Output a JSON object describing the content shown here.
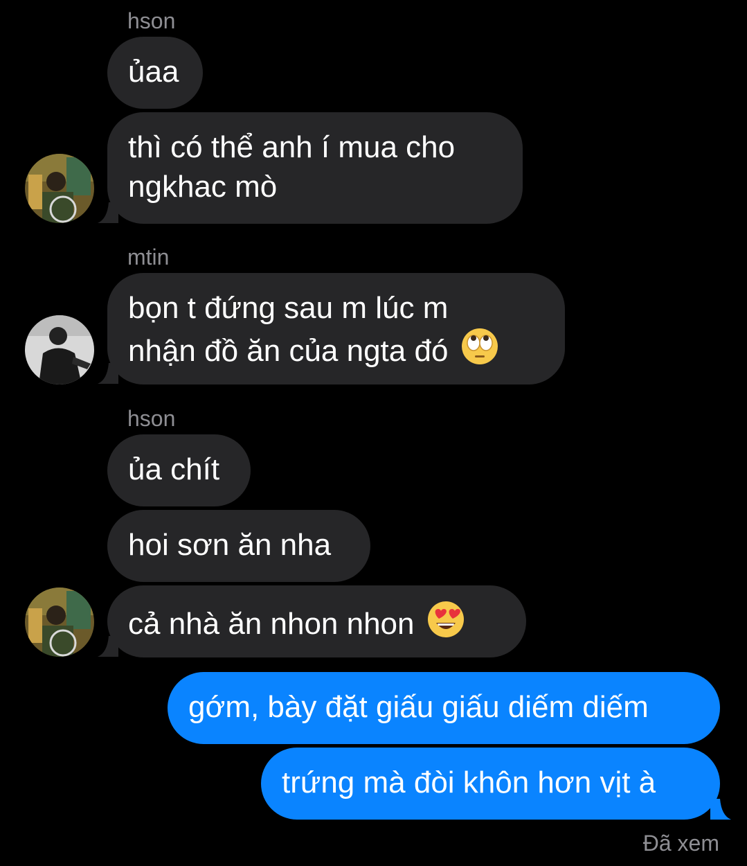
{
  "thread": {
    "groups": [
      {
        "sender": "hson"
      },
      {
        "sender": "mtin"
      },
      {
        "sender": "hson"
      }
    ],
    "messages": [
      {
        "text": "ủaa"
      },
      {
        "lines": [
          "thì có thể anh í mua cho",
          "ngkhac mò"
        ]
      },
      {
        "lines": [
          "bọn t đứng sau m lúc m",
          "nhận đồ ăn của ngta đó"
        ],
        "emoji": "face-with-rolling-eyes"
      },
      {
        "text": "ủa chít"
      },
      {
        "text": "hoi sơn ăn nha"
      },
      {
        "text": "cả nhà ăn nhon nhon",
        "emoji": "smiling-face-with-heart-eyes"
      },
      {
        "text": "gớm, bày đặt giấu giấu diếm diếm"
      },
      {
        "text": "trứng mà đòi khôn hơn vịt à"
      }
    ],
    "status": "Đã xem"
  },
  "colors": {
    "background": "#000000",
    "incoming_bubble": "#262628",
    "outgoing_bubble": "#0a84ff",
    "secondary_text": "#8e8e93"
  }
}
